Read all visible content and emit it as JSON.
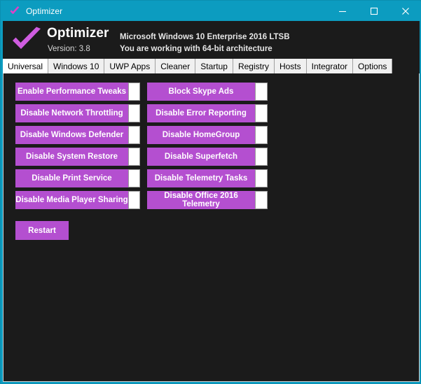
{
  "window": {
    "title": "Optimizer",
    "icon": "checkmark-icon",
    "accent_color": "#0c9cc0",
    "button_color": "#b44fd0",
    "background_color": "#1b1b1b",
    "controls": {
      "minimize": "minimize-icon",
      "maximize": "maximize-icon",
      "close": "close-icon"
    }
  },
  "header": {
    "logo": "checkmark-icon",
    "app_name": "Optimizer",
    "version": "Version: 3.8",
    "os_info": "Microsoft Windows 10 Enterprise 2016 LTSB",
    "architecture": "You are working with 64-bit architecture"
  },
  "tabs": [
    {
      "label": "Universal",
      "selected": true
    },
    {
      "label": "Windows 10",
      "selected": false
    },
    {
      "label": "UWP Apps",
      "selected": false
    },
    {
      "label": "Cleaner",
      "selected": false
    },
    {
      "label": "Startup",
      "selected": false
    },
    {
      "label": "Registry",
      "selected": false
    },
    {
      "label": "Hosts",
      "selected": false
    },
    {
      "label": "Integrator",
      "selected": false
    },
    {
      "label": "Options",
      "selected": false
    }
  ],
  "universal_tab": {
    "left_column": [
      {
        "label": "Enable Performance Tweaks",
        "checked": false
      },
      {
        "label": "Disable Network Throttling",
        "checked": false
      },
      {
        "label": "Disable Windows Defender",
        "checked": false
      },
      {
        "label": "Disable System Restore",
        "checked": false
      },
      {
        "label": "Disable Print Service",
        "checked": false
      },
      {
        "label": "Disable Media Player Sharing",
        "checked": false
      }
    ],
    "right_column": [
      {
        "label": "Block Skype Ads",
        "checked": false
      },
      {
        "label": "Disable Error Reporting",
        "checked": false
      },
      {
        "label": "Disable HomeGroup",
        "checked": false
      },
      {
        "label": "Disable Superfetch",
        "checked": false
      },
      {
        "label": "Disable Telemetry Tasks",
        "checked": false
      },
      {
        "label": "Disable Office 2016 Telemetry",
        "checked": false
      }
    ],
    "restart_label": "Restart"
  }
}
